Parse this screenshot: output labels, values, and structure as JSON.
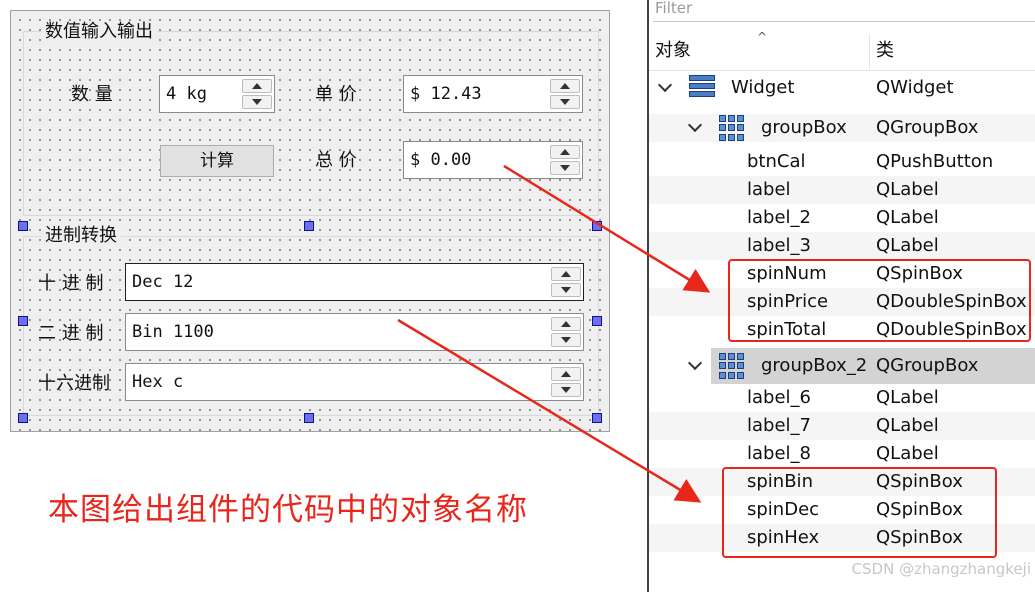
{
  "form": {
    "groupBox": {
      "title": "数值输入输出",
      "qty_label": "数 量",
      "price_label": "单 价",
      "total_label": "总 价",
      "calc_button": "计算",
      "spinNum_value": "4 kg",
      "spinPrice_value": "$ 12.43",
      "spinTotal_value": "$ 0.00"
    },
    "groupBox_2": {
      "title": "进制转换",
      "dec_label": "十 进 制",
      "bin_label": "二 进 制",
      "hex_label": "十六进制",
      "spinDec_value": "Dec 12",
      "spinBin_value": "Bin 1100",
      "spinHex_value": "Hex c"
    }
  },
  "caption": "本图给出组件的代码中的对象名称",
  "inspector": {
    "filter_placeholder": "Filter",
    "columns": [
      "对象",
      "类"
    ],
    "rows": [
      {
        "name": "Widget",
        "cls": "QWidget"
      },
      {
        "name": "groupBox",
        "cls": "QGroupBox"
      },
      {
        "name": "btnCal",
        "cls": "QPushButton"
      },
      {
        "name": "label",
        "cls": "QLabel"
      },
      {
        "name": "label_2",
        "cls": "QLabel"
      },
      {
        "name": "label_3",
        "cls": "QLabel"
      },
      {
        "name": "spinNum",
        "cls": "QSpinBox"
      },
      {
        "name": "spinPrice",
        "cls": "QDoubleSpinBox"
      },
      {
        "name": "spinTotal",
        "cls": "QDoubleSpinBox"
      },
      {
        "name": "groupBox_2",
        "cls": "QGroupBox"
      },
      {
        "name": "label_6",
        "cls": "QLabel"
      },
      {
        "name": "label_7",
        "cls": "QLabel"
      },
      {
        "name": "label_8",
        "cls": "QLabel"
      },
      {
        "name": "spinBin",
        "cls": "QSpinBox"
      },
      {
        "name": "spinDec",
        "cls": "QSpinBox"
      },
      {
        "name": "spinHex",
        "cls": "QSpinBox"
      }
    ]
  },
  "watermark": "CSDN @zhangzhangkeji",
  "colors": {
    "annotation": "#e8261c",
    "selected_row": "#d3d3d3"
  },
  "icons": {
    "widget": "widget-layout-icon",
    "groupbox": "groupbox-grid-icon"
  }
}
